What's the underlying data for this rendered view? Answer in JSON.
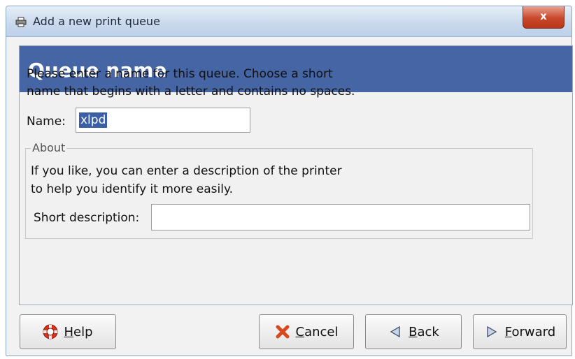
{
  "window": {
    "title": "Add a new print queue",
    "close_label": "x"
  },
  "banner": {
    "title": "Queue name"
  },
  "instructions": "Please enter a name for this queue.  Choose a short\nname that begins with a letter and contains no spaces.",
  "name_field": {
    "label": "Name:",
    "value": "xlpd"
  },
  "about": {
    "legend": "About",
    "text": "If you like, you can enter a description of the printer\nto help you identify it more easily.",
    "description_label": "Short description:",
    "description_value": ""
  },
  "buttons": {
    "help": {
      "accel": "H",
      "rest": "elp"
    },
    "cancel": {
      "accel": "C",
      "rest": "ancel"
    },
    "back": {
      "accel": "B",
      "rest": "ack"
    },
    "forward": {
      "accel": "F",
      "rest": "orward"
    }
  },
  "icons": {
    "title": "printer-icon",
    "help": "lifebuoy-icon",
    "cancel": "x-icon",
    "back": "triangle-left-icon",
    "forward": "triangle-right-icon"
  },
  "colors": {
    "banner": "#4565a4",
    "selection": "#3a5fa8",
    "cancel_icon": "#d84a1e"
  }
}
